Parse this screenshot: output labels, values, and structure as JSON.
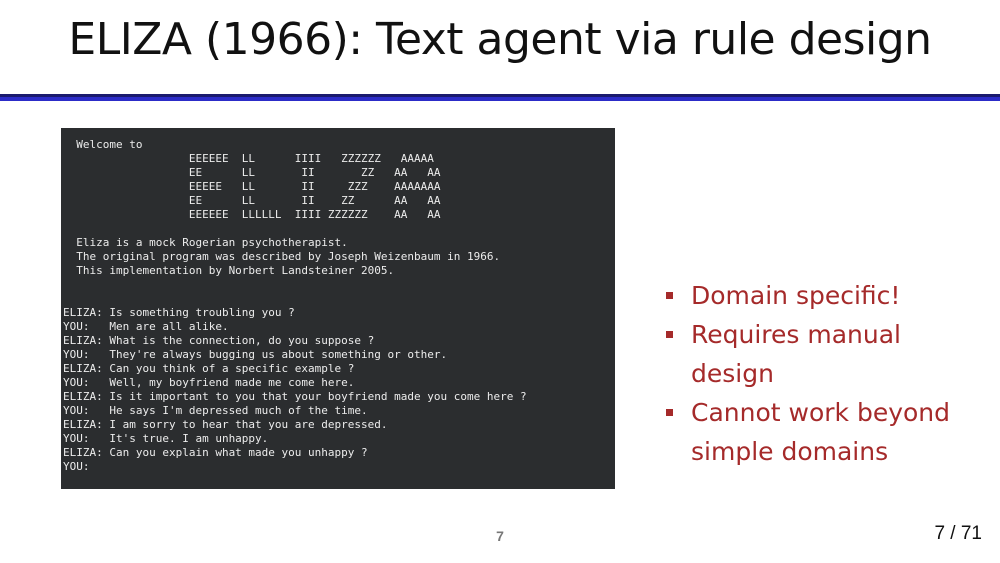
{
  "slide": {
    "title": "ELIZA (1966): Text agent via rule design",
    "footer_number": "7",
    "page_indicator": "7 / 71"
  },
  "terminal": {
    "text": "  Welcome to\n                   EEEEEE  LL      IIII   ZZZZZZ   AAAAA\n                   EE      LL       II       ZZ   AA   AA\n                   EEEEE   LL       II     ZZZ    AAAAAAA\n                   EE      LL       II    ZZ      AA   AA\n                   EEEEEE  LLLLLL  IIII ZZZZZZ    AA   AA\n\n  Eliza is a mock Rogerian psychotherapist.\n  The original program was described by Joseph Weizenbaum in 1966.\n  This implementation by Norbert Landsteiner 2005.\n\n\nELIZA: Is something troubling you ?\nYOU:   Men are all alike.\nELIZA: What is the connection, do you suppose ?\nYOU:   They're always bugging us about something or other.\nELIZA: Can you think of a specific example ?\nYOU:   Well, my boyfriend made me come here.\nELIZA: Is it important to you that your boyfriend made you come here ?\nYOU:   He says I'm depressed much of the time.\nELIZA: I am sorry to hear that you are depressed.\nYOU:   It's true. I am unhappy.\nELIZA: Can you explain what made you unhappy ?\nYOU:"
  },
  "bullets": [
    {
      "text": "Domain specific!"
    },
    {
      "text": "Requires manual design"
    },
    {
      "text": "Cannot work beyond simple domains"
    }
  ],
  "colors": {
    "bullet_text": "#a52a2a",
    "rule": "#2c2cc8",
    "terminal_bg": "#2b2d2f"
  }
}
